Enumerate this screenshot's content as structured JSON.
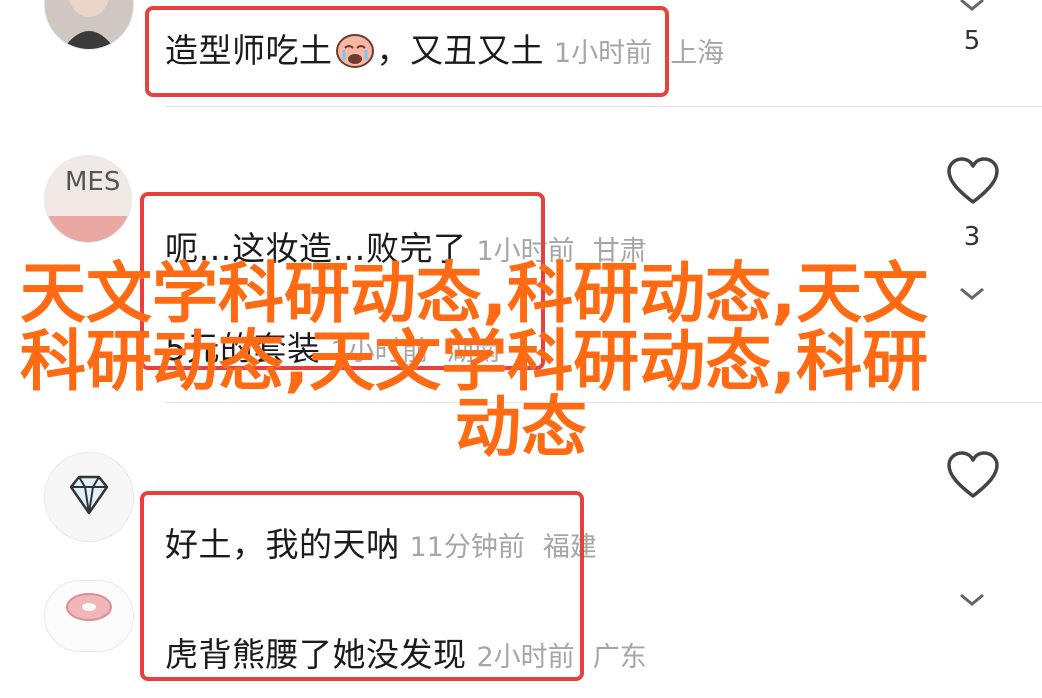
{
  "comments": [
    {
      "text": "造型师吃土",
      "emoji": "😭",
      "tail": "，又丑又土",
      "time": "1小时前",
      "location": "上海",
      "likes": "5"
    },
    {
      "text": "呃…这妆造…败完了",
      "time": "1小时前",
      "location": "甘肃",
      "likes": "3"
    },
    {
      "text": "5元的套装",
      "time": "1小时前",
      "location": "湖南"
    },
    {
      "text": "好土，我的天呐",
      "time": "11分钟前",
      "location": "福建"
    },
    {
      "text": "虎背熊腰了她没发现",
      "time": "2小时前",
      "location": "广东"
    }
  ],
  "avatar_texts": {
    "mes": "MES"
  },
  "watermark": {
    "line1": "天文学科研动态,科研动态,天文",
    "line2": "科研动态,天文学科研动态,科研",
    "line3": "动态"
  },
  "colors": {
    "highlight": "#e8413c",
    "watermark": "#ff6a13",
    "meta": "#a6a6a6"
  },
  "icons": [
    "heart-outline-icon",
    "chevron-down-icon",
    "diamond-icon"
  ]
}
